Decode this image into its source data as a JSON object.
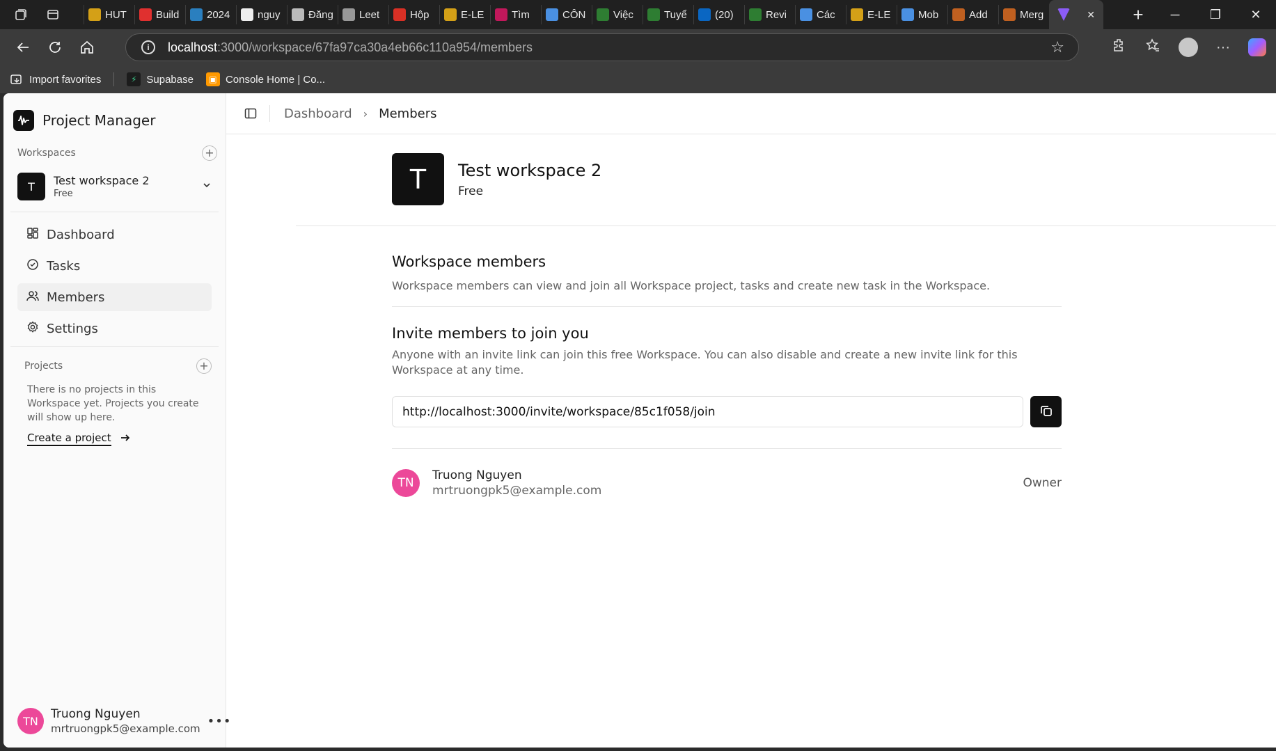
{
  "browser": {
    "tabs": [
      {
        "label": "HUT",
        "color": "#d4a017"
      },
      {
        "label": "Build",
        "color": "#e0302f"
      },
      {
        "label": "2024",
        "color": "#2a7fbf"
      },
      {
        "label": "nguy",
        "color": "#eeeeee"
      },
      {
        "label": "Đăng",
        "color": "#bbbbbb"
      },
      {
        "label": "Leet",
        "color": "#999999"
      },
      {
        "label": "Hộp",
        "color": "#d93025"
      },
      {
        "label": "E-LE",
        "color": "#d4a017"
      },
      {
        "label": "Tìm",
        "color": "#c2185b"
      },
      {
        "label": "CÔN",
        "color": "#4a90e2"
      },
      {
        "label": "Việc",
        "color": "#2e7d32"
      },
      {
        "label": "Tuyể",
        "color": "#2e7d32"
      },
      {
        "label": "(20)",
        "color": "#0a66c2"
      },
      {
        "label": "Revi",
        "color": "#2e7d32"
      },
      {
        "label": "Các",
        "color": "#4a90e2"
      },
      {
        "label": "E-LE",
        "color": "#d4a017"
      },
      {
        "label": "Mob",
        "color": "#4a90e2"
      },
      {
        "label": "Add",
        "color": "#c06020"
      },
      {
        "label": "Merg",
        "color": "#c06020"
      }
    ],
    "active_tab_color": "#8b5cf6",
    "url_host": "localhost",
    "url_path": ":3000/workspace/67fa97ca30a4eb66c110a954/members",
    "favorites": [
      {
        "label": "Import favorites",
        "icon": "import-icon"
      },
      {
        "label": "Supabase",
        "icon": "supabase-icon",
        "color": "#3ecf8e"
      },
      {
        "label": "Console Home | Co...",
        "icon": "aws-icon",
        "color": "#f90"
      }
    ]
  },
  "sidebar": {
    "brand": "Project Manager",
    "workspaces_label": "Workspaces",
    "current_workspace": {
      "initial": "T",
      "name": "Test workspace 2",
      "plan": "Free"
    },
    "nav": [
      {
        "label": "Dashboard",
        "icon": "dashboard-icon"
      },
      {
        "label": "Tasks",
        "icon": "tasks-icon"
      },
      {
        "label": "Members",
        "icon": "members-icon",
        "active": true
      },
      {
        "label": "Settings",
        "icon": "settings-icon"
      }
    ],
    "projects_label": "Projects",
    "projects_empty": "There is no projects in this Workspace yet. Projects you create will show up here.",
    "create_project": "Create a project",
    "user": {
      "initials": "TN",
      "name": "Truong Nguyen",
      "email": "mrtruongpk5@example.com"
    }
  },
  "main": {
    "breadcrumb": [
      "Dashboard",
      "Members"
    ],
    "workspace": {
      "initial": "T",
      "name": "Test workspace 2",
      "plan": "Free"
    },
    "members_title": "Workspace members",
    "members_desc": "Workspace members can view and join all Workspace project, tasks and create new task in the Workspace.",
    "invite_title": "Invite members to join you",
    "invite_desc": "Anyone with an invite link can join this free Workspace. You can also disable and create a new invite link for this Workspace at any time.",
    "invite_link": "http://localhost:3000/invite/workspace/85c1f058/join",
    "members": [
      {
        "initials": "TN",
        "name": "Truong Nguyen",
        "email": "mrtruongpk5@example.com",
        "role": "Owner"
      }
    ]
  },
  "colors": {
    "accent": "#111111",
    "avatar_pink": "#ec4899"
  }
}
